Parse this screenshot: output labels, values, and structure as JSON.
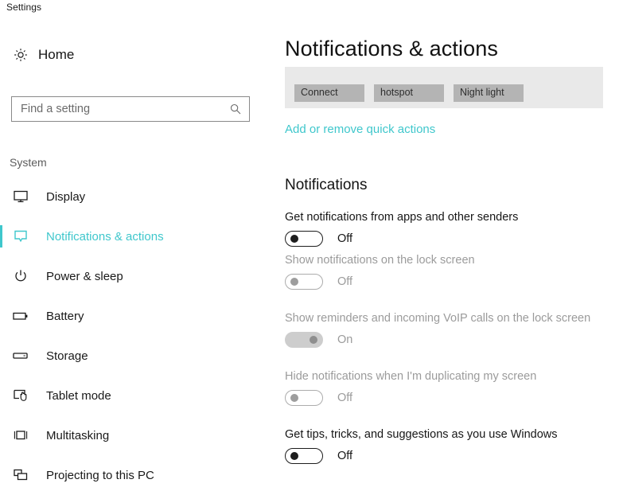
{
  "window": {
    "title": "Settings"
  },
  "sidebar": {
    "home": {
      "label": "Home",
      "icon": "gear-icon"
    },
    "search": {
      "placeholder": "Find a setting",
      "value": "",
      "icon": "search-icon"
    },
    "group_label": "System",
    "items": [
      {
        "label": "Display",
        "icon": "monitor-icon",
        "selected": false
      },
      {
        "label": "Notifications & actions",
        "icon": "speech-bubble-icon",
        "selected": true
      },
      {
        "label": "Power & sleep",
        "icon": "power-icon",
        "selected": false
      },
      {
        "label": "Battery",
        "icon": "battery-icon",
        "selected": false
      },
      {
        "label": "Storage",
        "icon": "drive-icon",
        "selected": false
      },
      {
        "label": "Tablet mode",
        "icon": "tablet-hand-icon",
        "selected": false
      },
      {
        "label": "Multitasking",
        "icon": "multitask-icon",
        "selected": false
      },
      {
        "label": "Projecting to this PC",
        "icon": "project-icon",
        "selected": false
      }
    ]
  },
  "main": {
    "title": "Notifications & actions",
    "quick_actions": {
      "tiles": [
        "Connect",
        "hotspot",
        "Night light"
      ],
      "link_label": "Add or remove quick actions"
    },
    "notifications": {
      "section_title": "Notifications",
      "settings": [
        {
          "label": "Get notifications from apps and other senders",
          "state_label": "Off",
          "on": false,
          "disabled": false
        },
        {
          "label": "Show notifications on the lock screen",
          "state_label": "Off",
          "on": false,
          "disabled": true
        },
        {
          "label": "Show reminders and incoming VoIP calls on the lock screen",
          "state_label": "On",
          "on": true,
          "disabled": true
        },
        {
          "label": "Hide notifications when I'm duplicating my screen",
          "state_label": "Off",
          "on": false,
          "disabled": true
        },
        {
          "label": "Get tips, tricks, and suggestions as you use Windows",
          "state_label": "Off",
          "on": false,
          "disabled": false
        }
      ]
    }
  },
  "colors": {
    "accent": "#3fc7cc",
    "tray_background": "#e9e9e9",
    "tile": "#b4b4b4",
    "disabled_text": "#9b9b9b"
  }
}
